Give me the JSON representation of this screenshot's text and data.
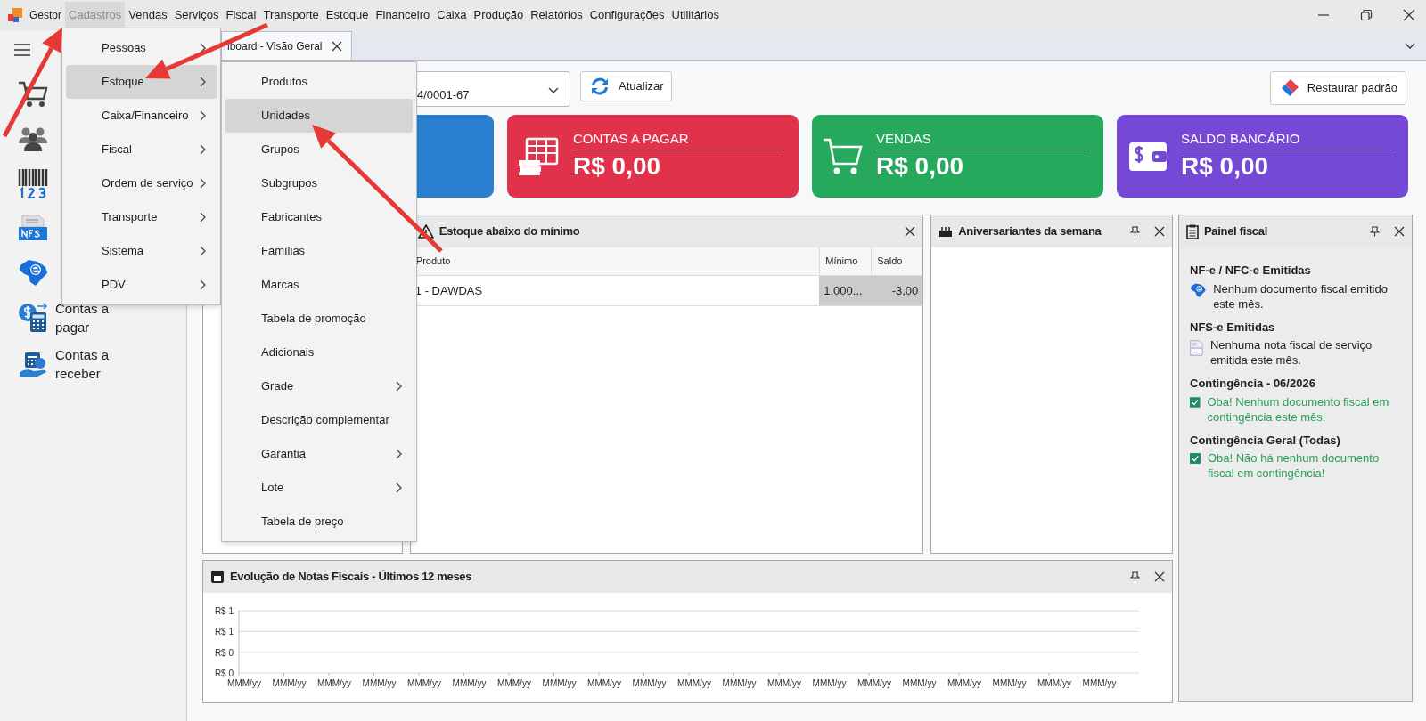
{
  "app": {
    "name": "Gestor"
  },
  "menu_bar": [
    {
      "label": "Cadastros",
      "selected": true
    },
    {
      "label": "Vendas",
      "selected": false
    },
    {
      "label": "Serviços",
      "selected": false
    },
    {
      "label": "Fiscal",
      "selected": false
    },
    {
      "label": "Transporte",
      "selected": false
    },
    {
      "label": "Estoque",
      "selected": false
    },
    {
      "label": "Financeiro",
      "selected": false
    },
    {
      "label": "Caixa",
      "selected": false
    },
    {
      "label": "Produção",
      "selected": false
    },
    {
      "label": "Relatórios",
      "selected": false
    },
    {
      "label": "Configurações",
      "selected": false
    },
    {
      "label": "Utilitários",
      "selected": false
    }
  ],
  "sidebar": {
    "items": [
      {
        "kind": "cart"
      },
      {
        "kind": "people"
      },
      {
        "kind": "barcode"
      },
      {
        "kind": "nfse"
      },
      {
        "kind": "nfe"
      },
      {
        "kind": "payable",
        "label": "Contas a pagar"
      },
      {
        "kind": "receivable",
        "label": "Contas a receber"
      }
    ]
  },
  "tabs": [
    {
      "label": "hboard - Visão Geral",
      "selected": true
    }
  ],
  "toolbar": {
    "company_select": {
      "value": "4/0001-67"
    },
    "refresh_button": "Atualizar",
    "reset_button": "Restaurar padrão"
  },
  "cards": [
    {
      "kind": "blank",
      "color": "#2a7fd0"
    },
    {
      "kind": "payable",
      "title": "CONTAS A PAGAR",
      "value": "R$ 0,00",
      "color": "#e0334b"
    },
    {
      "kind": "sales",
      "title": "VENDAS",
      "value": "R$ 0,00",
      "color": "#26a95c"
    },
    {
      "kind": "bank",
      "title": "SALDO BANCÁRIO",
      "value": "R$ 0,00",
      "color": "#7548d6"
    }
  ],
  "stock_panel": {
    "title": "Estoque abaixo do mínimo",
    "columns": [
      "Produto",
      "Mínimo",
      "Saldo"
    ],
    "rows": [
      [
        "1 - DAWDAS",
        "1.000...",
        "-3,00"
      ]
    ]
  },
  "birthday_panel": {
    "title": "Aniversariantes da semana"
  },
  "fiscal_panel": {
    "title": "Painel fiscal",
    "sections": [
      {
        "heading": "NF-e / NFC-e Emitidas",
        "items": [
          {
            "kind": "nfe",
            "text": "Nenhum documento fiscal emitido este mês."
          }
        ]
      },
      {
        "heading": "NFS-e Emitidas",
        "items": [
          {
            "kind": "nfse",
            "text": "Nenhuma nota fiscal de serviço emitida este mês."
          }
        ]
      },
      {
        "heading": "Contingência - 06/2026",
        "items": [
          {
            "kind": "ok",
            "text": "Oba! Nenhum documento fiscal em contingência este mês!"
          }
        ]
      },
      {
        "heading": "Contingência Geral (Todas)",
        "items": [
          {
            "kind": "ok",
            "text": "Oba! Não há nenhum documento fiscal em contingência!"
          }
        ]
      }
    ]
  },
  "chart_panel": {
    "title": "Evolução de Notas Fiscais - Últimos 12 meses",
    "y_axis_labels": [
      "R$ 1",
      "R$ 1",
      "R$ 0",
      "R$ 0"
    ],
    "chart_data": {
      "type": "other",
      "categories": [
        "MMM/yy",
        "MMM/yy",
        "MMM/yy",
        "MMM/yy",
        "MMM/yy",
        "MMM/yy",
        "MMM/yy",
        "MMM/yy",
        "MMM/yy",
        "MMM/yy",
        "MMM/yy",
        "MMM/yy",
        "MMM/yy",
        "MMM/yy",
        "MMM/yy",
        "MMM/yy",
        "MMM/yy",
        "MMM/yy",
        "MMM/yy",
        "MMM/yy"
      ]
    }
  },
  "cadastros_menu": [
    {
      "label": "Pessoas",
      "submenu": true,
      "selected": false
    },
    {
      "label": "Estoque",
      "submenu": true,
      "selected": true
    },
    {
      "label": "Caixa/Financeiro",
      "submenu": true,
      "selected": false
    },
    {
      "label": "Fiscal",
      "submenu": true,
      "selected": false
    },
    {
      "label": "Ordem de serviço",
      "submenu": true,
      "selected": false
    },
    {
      "label": "Transporte",
      "submenu": true,
      "selected": false
    },
    {
      "label": "Sistema",
      "submenu": true,
      "selected": false
    },
    {
      "label": "PDV",
      "submenu": true,
      "selected": false
    }
  ],
  "estoque_submenu": [
    {
      "label": "Produtos",
      "submenu": false,
      "selected": false
    },
    {
      "label": "Unidades",
      "submenu": false,
      "selected": true
    },
    {
      "label": "Grupos",
      "submenu": false,
      "selected": false
    },
    {
      "label": "Subgrupos",
      "submenu": false,
      "selected": false
    },
    {
      "label": "Fabricantes",
      "submenu": false,
      "selected": false
    },
    {
      "label": "Famílias",
      "submenu": false,
      "selected": false
    },
    {
      "label": "Marcas",
      "submenu": false,
      "selected": false
    },
    {
      "label": "Tabela de promoção",
      "submenu": false,
      "selected": false
    },
    {
      "label": "Adicionais",
      "submenu": false,
      "selected": false
    },
    {
      "label": "Grade",
      "submenu": true,
      "selected": false
    },
    {
      "label": "Descrição complementar",
      "submenu": false,
      "selected": false
    },
    {
      "label": "Garantia",
      "submenu": true,
      "selected": false
    },
    {
      "label": "Lote",
      "submenu": true,
      "selected": false
    },
    {
      "label": "Tabela de preço",
      "submenu": false,
      "selected": false
    }
  ]
}
